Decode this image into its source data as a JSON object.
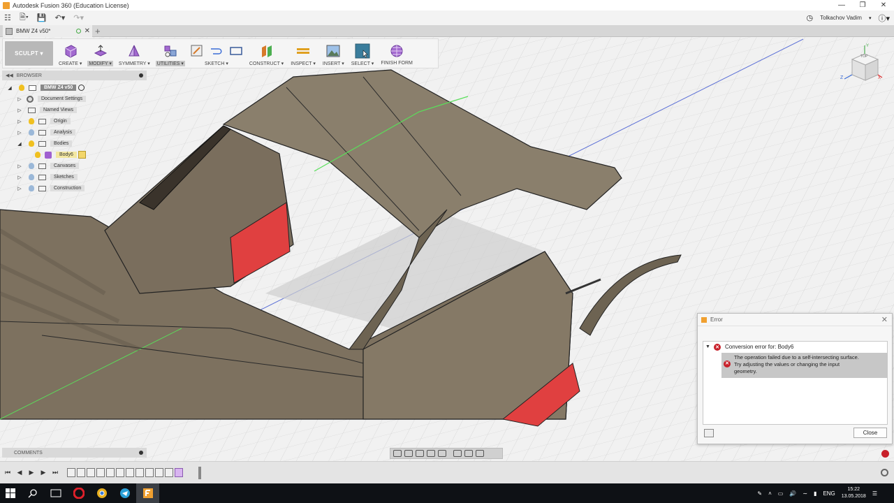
{
  "window": {
    "title": "Autodesk Fusion 360 (Education License)",
    "user": "Tolkachov Vadim"
  },
  "document_tab": {
    "name": "BMW Z4 v50*"
  },
  "toolbar": {
    "workspace": "SCULPT ▾",
    "groups": [
      {
        "label": "CREATE ▾"
      },
      {
        "label": "MODIFY ▾"
      },
      {
        "label": "SYMMETRY ▾"
      },
      {
        "label": "UTILITIES ▾"
      },
      {
        "label": "SKETCH ▾"
      },
      {
        "label": "CONSTRUCT ▾"
      },
      {
        "label": "INSPECT ▾"
      },
      {
        "label": "INSERT ▾"
      },
      {
        "label": "SELECT ▾"
      },
      {
        "label": "FINISH FORM"
      }
    ]
  },
  "browser": {
    "title": "BROWSER",
    "items": [
      {
        "label": "BMW Z4 v50"
      },
      {
        "label": "Document Settings"
      },
      {
        "label": "Named Views"
      },
      {
        "label": "Origin"
      },
      {
        "label": "Analysis"
      },
      {
        "label": "Bodies"
      },
      {
        "label": "Body6"
      },
      {
        "label": "Canvases"
      },
      {
        "label": "Sketches"
      },
      {
        "label": "Construction"
      }
    ]
  },
  "comments": {
    "title": "COMMENTS"
  },
  "viewcube": {
    "top": "TOP",
    "axis_x": "X",
    "axis_y": "Y",
    "axis_z": "Z"
  },
  "error_dialog": {
    "title": "Error",
    "heading": "Conversion error for: Body6",
    "message_1": "The operation failed due to a self-intersecting surface.",
    "message_2": "Try adjusting the values or changing the input",
    "message_3": "geometry.",
    "close_label": "Close"
  },
  "taskbar": {
    "language": "ENG",
    "time": "15:22",
    "date": "13.05.2018"
  },
  "colors": {
    "error_red": "#c8202a",
    "model_surface": "#7d715f",
    "self_intersection": "#e04040",
    "toolbar_bg": "#f5f5f5"
  }
}
